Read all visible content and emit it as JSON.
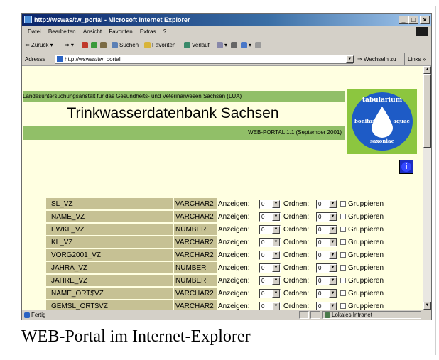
{
  "window": {
    "title": "http://wswas/tw_portal - Microsoft Internet Explorer"
  },
  "menu": [
    "Datei",
    "Bearbeiten",
    "Ansicht",
    "Favoriten",
    "Extras",
    "?"
  ],
  "toolbar": {
    "back": "Zurück",
    "search": "Suchen",
    "favorites": "Favoriten",
    "history": "Verlauf"
  },
  "address": {
    "label": "Adresse",
    "url": "http://wswas/tw_portal",
    "go": "Wechseln zu",
    "links": "Links"
  },
  "header": {
    "agency": "Landesuntersuchungsanstalt für das Gesundheits- und Veterinärwesen Sachsen (LUA)",
    "title": "Trinkwasserdatenbank Sachsen",
    "version": "WEB-PORTAL 1.1 (September 2001)"
  },
  "logo": {
    "top": "tabularium",
    "left": "bonitas",
    "right": "aquae",
    "bottom": "saxoniae"
  },
  "info_icon": {
    "glyph": "i"
  },
  "labels": {
    "show": "Anzeigen:",
    "order": "Ordnen:",
    "group": "Gruppieren"
  },
  "rows": [
    {
      "name": "SL_VZ",
      "type": "VARCHAR2",
      "show": "0",
      "order": "0"
    },
    {
      "name": "NAME_VZ",
      "type": "VARCHAR2",
      "show": "0",
      "order": "0"
    },
    {
      "name": "EWKL_VZ",
      "type": "NUMBER",
      "show": "0",
      "order": "0"
    },
    {
      "name": "KL_VZ",
      "type": "VARCHAR2",
      "show": "0",
      "order": "0"
    },
    {
      "name": "VORG2001_VZ",
      "type": "VARCHAR2",
      "show": "0",
      "order": "0"
    },
    {
      "name": "JAHRA_VZ",
      "type": "NUMBER",
      "show": "0",
      "order": "0"
    },
    {
      "name": "JAHRE_VZ",
      "type": "NUMBER",
      "show": "0",
      "order": "0"
    },
    {
      "name": "NAME_ORT$VZ",
      "type": "VARCHAR2",
      "show": "0",
      "order": "0"
    },
    {
      "name": "GEMSL_ORT$VZ",
      "type": "VARCHAR2",
      "show": "0",
      "order": "0"
    }
  ],
  "status": {
    "text": "Fertig",
    "zone": "Lokales Intranet"
  },
  "caption": "WEB-Portal im Internet-Explorer",
  "colors": {
    "green_band": "#91bf68",
    "page_bg": "#ffffe1",
    "row_bg": "#c6c194",
    "logo_blue": "#1e5bc6",
    "logo_green": "#8cc63f"
  }
}
